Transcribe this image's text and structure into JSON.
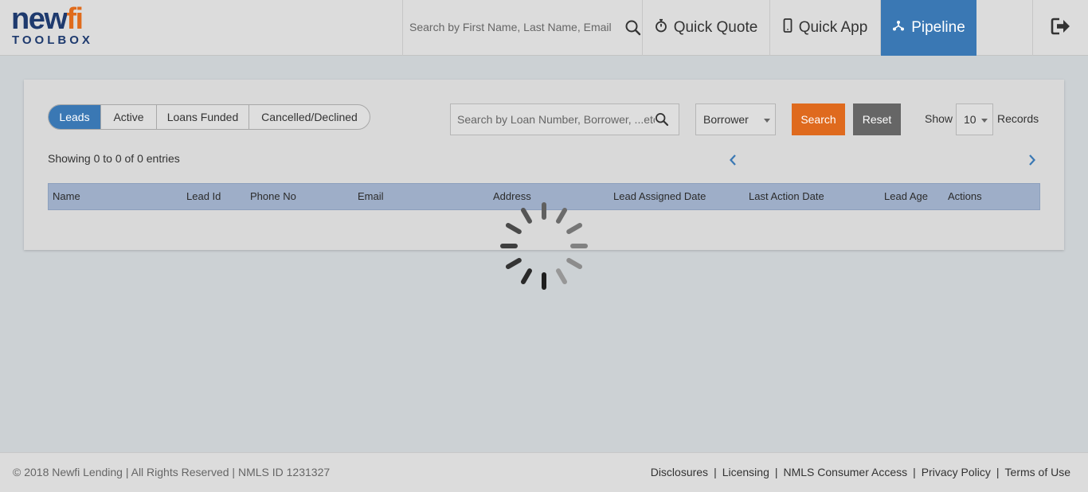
{
  "brand": {
    "logo_main_a": "new",
    "logo_main_b": "fi",
    "logo_sub": "TOOLBOX",
    "colors": {
      "navy": "#1e3a6e",
      "orange": "#e06b1c",
      "blue": "#3a78b4"
    }
  },
  "header": {
    "search_placeholder": "Search by First Name, Last Name, Email",
    "search_icon": "search-icon",
    "nav": [
      {
        "label": "Quick Quote",
        "icon": "stopwatch-icon"
      },
      {
        "label": "Quick App",
        "icon": "mobile-phone-icon"
      },
      {
        "label": "Pipeline",
        "icon": "pipeline-icon",
        "active": true
      }
    ],
    "logout_icon": "logout-icon"
  },
  "filters": {
    "tabs": [
      {
        "label": "Leads",
        "active": true
      },
      {
        "label": "Active"
      },
      {
        "label": "Loans Funded"
      },
      {
        "label": "Cancelled/Declined"
      }
    ],
    "loan_search_placeholder": "Search by Loan Number, Borrower, ...etc",
    "select_value": "Borrower",
    "search_label": "Search",
    "reset_label": "Reset",
    "show_label": "Show",
    "records_value": "10",
    "records_label": "Records"
  },
  "table": {
    "entries_text": "Showing 0 to 0 of 0 entries",
    "columns": [
      "Name",
      "Lead Id",
      "Phone No",
      "Email",
      "Address",
      "Lead Assigned Date",
      "Last Action Date",
      "Lead Age",
      "Actions"
    ],
    "rows": []
  },
  "footer": {
    "copyright": "© 2018 Newfi Lending | All Rights Reserved | NMLS ID 1231327",
    "links": [
      "Disclosures",
      "Licensing",
      "NMLS Consumer Access",
      "Privacy Policy",
      "Terms of Use"
    ],
    "separator": "|"
  }
}
